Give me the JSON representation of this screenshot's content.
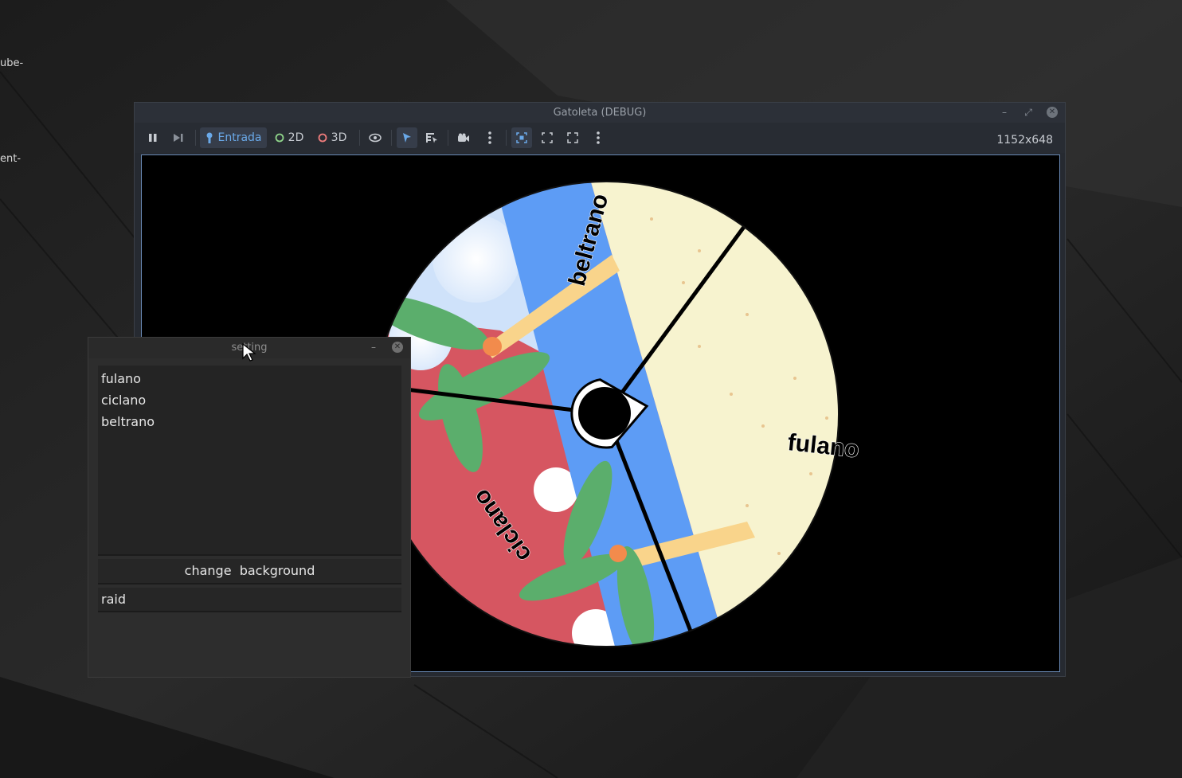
{
  "desktop": {
    "labels": [
      "ube-",
      "ent-"
    ]
  },
  "window": {
    "title": "Gatoleta (DEBUG)",
    "minimize_icon": "minimize-icon",
    "maximize_icon": "maximize-icon",
    "close_icon": "close-icon"
  },
  "toolbar": {
    "pause_icon": "pause-icon",
    "next_frame_icon": "next-frame-icon",
    "input_label": "Entrada",
    "mode_2d_label": "2D",
    "mode_3d_label": "3D",
    "visibility_icon": "eye-icon",
    "select_icon": "select-arrow-icon",
    "list_select_icon": "list-select-icon",
    "camera_icon": "camera-icon",
    "more_icon": "kebab-icon",
    "resolution": "1152x648"
  },
  "wheel": {
    "segments": [
      {
        "label": "fulano"
      },
      {
        "label": "ciclano"
      },
      {
        "label": "beltrano"
      }
    ]
  },
  "settings": {
    "title": "setting",
    "names": [
      "fulano",
      "ciclano",
      "beltrano"
    ],
    "change_background_label": "change  background",
    "raid_value": "raid"
  },
  "colors": {
    "accent": "#6aa9e9",
    "sand": "#f7f3cf",
    "water": "#5d9cf5",
    "red": "#d65661",
    "viewport_bg": "#000000"
  }
}
